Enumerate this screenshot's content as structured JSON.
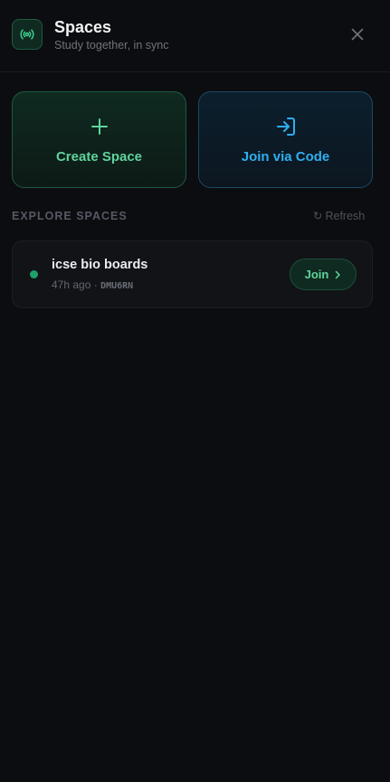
{
  "header": {
    "title": "Spaces",
    "subtitle": "Study together, in sync",
    "app_icon": "broadcast-icon",
    "close_icon": "close-icon"
  },
  "actions": {
    "create": {
      "label": "Create Space",
      "icon": "plus-icon",
      "color": "#5fd39c"
    },
    "join_code": {
      "label": "Join via Code",
      "icon": "login-arrow-icon",
      "color": "#2eaef0"
    }
  },
  "explore": {
    "title": "EXPLORE SPACES",
    "refresh_label": "Refresh",
    "refresh_icon": "↻",
    "spaces": [
      {
        "name": "icse bio boards",
        "time": "47h ago",
        "separator": "·",
        "code": "DMU6RN",
        "status_color": "#1f9e6a",
        "join_label": "Join"
      }
    ]
  },
  "colors": {
    "background": "#0c0d10",
    "accent_green": "#5fd39c",
    "accent_blue": "#2eaef0"
  }
}
